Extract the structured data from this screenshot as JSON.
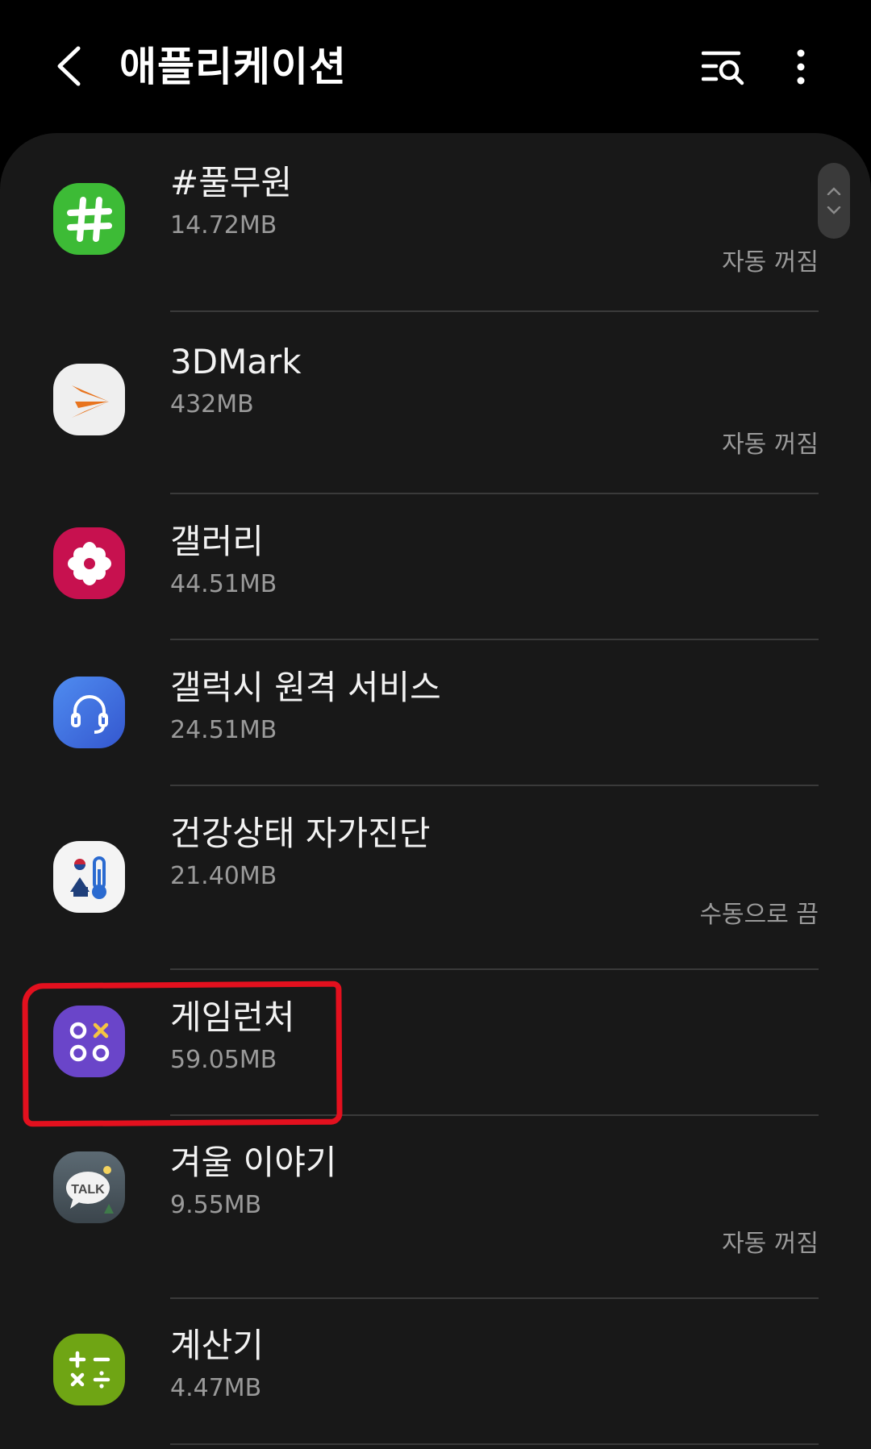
{
  "header": {
    "title": "애플리케이션",
    "back_icon": "back-arrow-icon",
    "search_icon": "filter-search-icon",
    "more_icon": "more-vert-icon"
  },
  "apps": [
    {
      "name": "#풀무원",
      "size": "14.72MB",
      "status": "자동 꺼짐",
      "icon": "pulmuone-app-icon",
      "color": "#3dbb36"
    },
    {
      "name": "3DMark",
      "size": "432MB",
      "status": "자동 꺼짐",
      "icon": "3dmark-app-icon",
      "color": "#efefef"
    },
    {
      "name": "갤러리",
      "size": "44.51MB",
      "status": "",
      "icon": "gallery-app-icon",
      "color": "#c7114f"
    },
    {
      "name": "갤럭시 원격 서비스",
      "size": "24.51MB",
      "status": "",
      "icon": "remote-support-app-icon",
      "color": "#3f6fe0"
    },
    {
      "name": "건강상태 자가진단",
      "size": "21.40MB",
      "status": "수동으로 끔",
      "icon": "health-check-app-icon",
      "color": "#f4f4f4"
    },
    {
      "name": "게임런처",
      "size": "59.05MB",
      "status": "",
      "icon": "game-launcher-app-icon",
      "color": "#6a45c9"
    },
    {
      "name": "겨울 이야기",
      "size": "9.55MB",
      "status": "자동 꺼짐",
      "icon": "kakaotalk-winter-app-icon",
      "color": "#4c5a63"
    },
    {
      "name": "계산기",
      "size": "4.47MB",
      "status": "",
      "icon": "calculator-app-icon",
      "color": "#6fa514"
    }
  ],
  "highlight_color": "#e3101e"
}
